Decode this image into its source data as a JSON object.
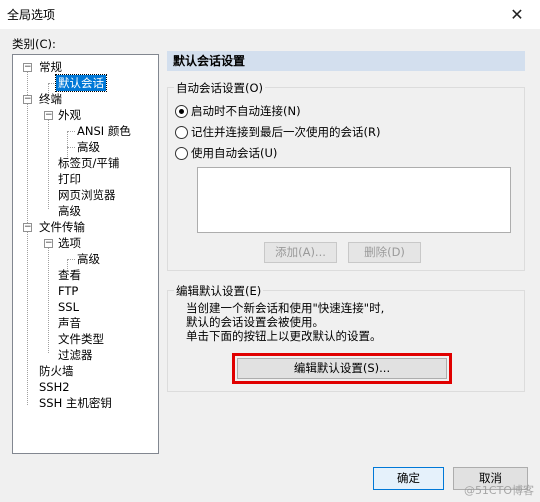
{
  "window": {
    "title": "全局选项",
    "close_glyph": "✕"
  },
  "category_label": "类别(C):",
  "tree": {
    "expander_minus": "−",
    "items": [
      {
        "label": "常规",
        "expander": true
      },
      {
        "label": "默认会话",
        "selected": true
      },
      {
        "label": "终端",
        "expander": true
      },
      {
        "label": "外观",
        "expander": true
      },
      {
        "label": "ANSI 颜色"
      },
      {
        "label": "高级"
      },
      {
        "label": "标签页/平铺"
      },
      {
        "label": "打印"
      },
      {
        "label": "网页浏览器"
      },
      {
        "label": "高级"
      },
      {
        "label": "文件传输",
        "expander": true
      },
      {
        "label": "选项",
        "expander": true
      },
      {
        "label": "高级"
      },
      {
        "label": "查看"
      },
      {
        "label": "FTP"
      },
      {
        "label": "SSL"
      },
      {
        "label": "声音"
      },
      {
        "label": "文件类型"
      },
      {
        "label": "过滤器"
      },
      {
        "label": "防火墙"
      },
      {
        "label": "SSH2"
      },
      {
        "label": "SSH 主机密钥"
      }
    ]
  },
  "panel": {
    "header": "默认会话设置",
    "auto_group": {
      "title": "自动会话设置(O)",
      "options": [
        {
          "label": "启动时不自动连接(N)",
          "checked": true
        },
        {
          "label": "记住并连接到最后一次使用的会话(R)",
          "checked": false
        },
        {
          "label": "使用自动会话(U)",
          "checked": false
        }
      ],
      "add_button": "添加(A)...",
      "delete_button": "删除(D)"
    },
    "edit_group": {
      "title": "编辑默认设置(E)",
      "description": [
        "当创建一个新会话和使用\"快速连接\"时,",
        "默认的会话设置会被使用。",
        "单击下面的按钮上以更改默认的设置。"
      ],
      "edit_button": "编辑默认设置(S)..."
    }
  },
  "footer": {
    "ok_button": "确定",
    "cancel_button": "取消"
  },
  "watermark": "@51CTO博客",
  "colors": {
    "selection": "#0078d7",
    "header_bg": "#d3dfee",
    "highlight_border": "#e00000"
  }
}
